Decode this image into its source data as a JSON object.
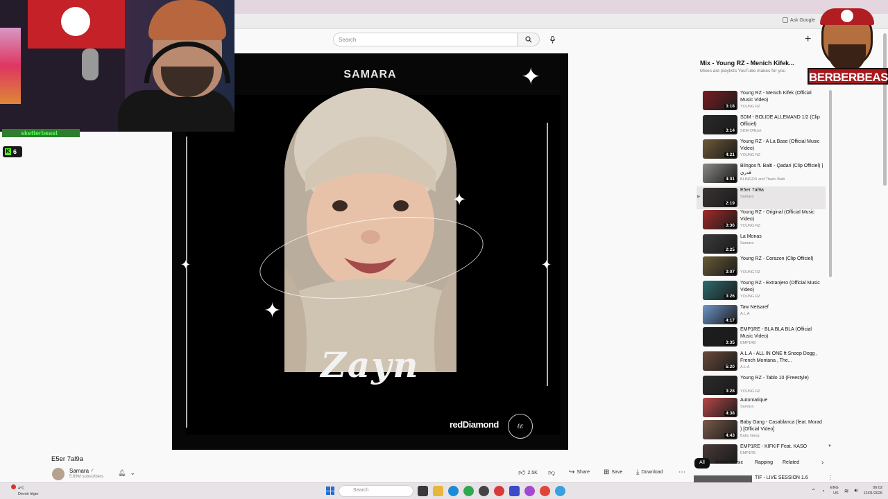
{
  "browser": {
    "ask_google": "Ask Google"
  },
  "header": {
    "search_placeholder": "Search",
    "create_icon": "plus-icon"
  },
  "video": {
    "cover_title": "SAMARA",
    "cover_name": "Zayn",
    "cover_logo": "redDiamond",
    "cover_seal": "ℓε",
    "title": "E5er 7al9a",
    "channel": "Samara",
    "channel_badge": "✓",
    "subscribers": "5.89M subscribers"
  },
  "overlay": {
    "kick_username": "sketterbeast",
    "kick_viewers": "6",
    "brand": "BERBERBEAST"
  },
  "actions": {
    "likes": "2.5K",
    "share": "Share",
    "save": "Save",
    "download": "Download"
  },
  "playlist": {
    "title": "Mix - Young RZ - Menich Kifek...",
    "subtitle": "Mixes are playlists YouTube makes for you",
    "items": [
      {
        "title": "Young RZ - Menich Kifek (Official Music Video)",
        "channel": "YOUNG RZ",
        "duration": "3:18",
        "color": "#7a1d24"
      },
      {
        "title": "SDM - BOLIDE ALLEMAND 1/2 (Clip Officiel)",
        "channel": "SDM Officiel",
        "duration": "3:14",
        "color": "#2a2a2a"
      },
      {
        "title": "Young RZ - A La Base (Official Music Video)",
        "channel": "YOUNG RZ",
        "duration": "4:21",
        "color": "#6e5a3a"
      },
      {
        "title": "Blingos ft. Balti - Qadari (Clip Officiel) | قدري",
        "channel": "BLINGOS and Tbarki Balti",
        "duration": "4:01",
        "color": "#8b8a86"
      },
      {
        "title": "E5er 7al9a",
        "channel": "Samara",
        "duration": "2:19",
        "color": "#3a3434"
      },
      {
        "title": "Young RZ - Original (Official Music Video)",
        "channel": "YOUNG RZ",
        "duration": "3:36",
        "color": "#a32a2a"
      },
      {
        "title": "La Monas",
        "channel": "Samara",
        "duration": "2:25",
        "color": "#3b3b3b"
      },
      {
        "title": "Young RZ - Corazon (Clip Officiel)",
        "channel": "YOUNG RZ",
        "duration": "3:07",
        "color": "#6b5b36"
      },
      {
        "title": "Young RZ - Extranjero (Official Music Video)",
        "channel": "YOUNG RZ",
        "duration": "3:26",
        "color": "#2f6a6e"
      },
      {
        "title": "Taw Netsaref",
        "channel": "A.L.A",
        "duration": "4:17",
        "color": "#6d96c9"
      },
      {
        "title": "EMP1RE - BLA BLA BLA (Official Music Video)",
        "channel": "EMP1RE",
        "duration": "3:35",
        "color": "#1e1e1e"
      },
      {
        "title": "A.L.A - ALL IN ONE ft Snoop Dogg , French Montana , The...",
        "channel": "A.L.A",
        "duration": "5:20",
        "color": "#6a4a3a"
      },
      {
        "title": "Young RZ - Tablo 10 (Freestyle)",
        "channel": "YOUNG RZ",
        "duration": "3:28",
        "color": "#2b2b2b"
      },
      {
        "title": "Automatique",
        "channel": "Samara",
        "duration": "4:38",
        "color": "#b84848"
      },
      {
        "title": "Baby Gang - Casablanca (feat. Morad ) [Official Video]",
        "channel": "Baby Gang",
        "duration": "4:43",
        "color": "#7a5a4a"
      },
      {
        "title": "EMP1RE - KIFKIF Feat. KASO",
        "channel": "EMP1RE",
        "duration": "",
        "color": "#4a3a3a"
      }
    ]
  },
  "chips": [
    "All",
    "Arabic Music",
    "Rapping",
    "Related"
  ],
  "next_video": {
    "title": "TIF - LIVE SESSION 1.6"
  },
  "taskbar": {
    "weather_temp": "4°C",
    "weather_desc": "Devoir léger",
    "search_placeholder": "Search",
    "lang": "ENG",
    "region": "US",
    "time": "06:02",
    "date": "12/01/2026"
  }
}
